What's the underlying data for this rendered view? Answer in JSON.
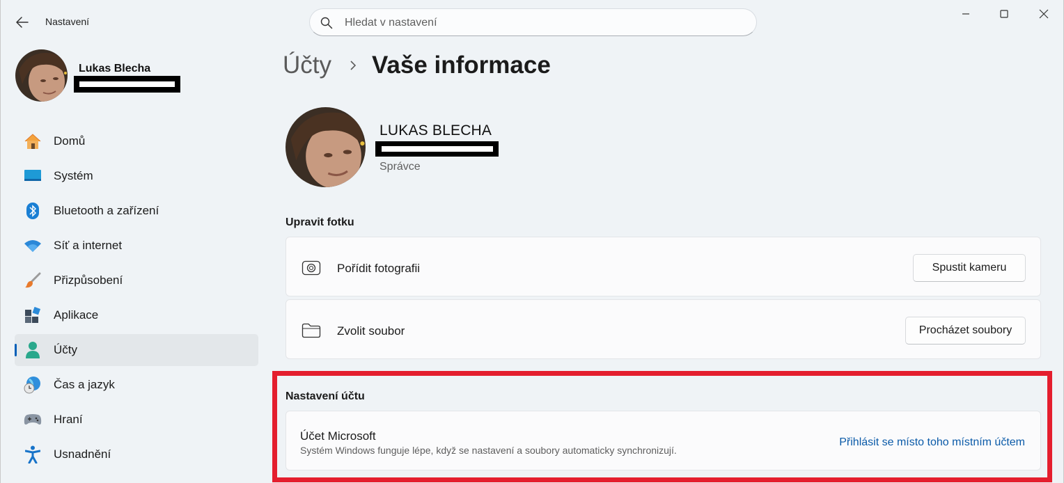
{
  "window": {
    "app_title": "Nastavení",
    "search_placeholder": "Hledat v nastavení"
  },
  "sidebar": {
    "profile_name": "Lukas Blecha",
    "items": [
      {
        "label": "Domů",
        "icon": "home-icon"
      },
      {
        "label": "Systém",
        "icon": "system-icon"
      },
      {
        "label": "Bluetooth a zařízení",
        "icon": "bluetooth-icon"
      },
      {
        "label": "Síť a internet",
        "icon": "wifi-icon"
      },
      {
        "label": "Přizpůsobení",
        "icon": "brush-icon"
      },
      {
        "label": "Aplikace",
        "icon": "apps-icon"
      },
      {
        "label": "Účty",
        "icon": "account-icon",
        "selected": true
      },
      {
        "label": "Čas a jazyk",
        "icon": "globe-clock-icon"
      },
      {
        "label": "Hraní",
        "icon": "gamepad-icon"
      },
      {
        "label": "Usnadnění",
        "icon": "accessibility-icon"
      }
    ]
  },
  "main": {
    "breadcrumb_parent": "Účty",
    "breadcrumb_current": "Vaše informace",
    "user_name": "LUKAS BLECHA",
    "user_role": "Správce",
    "edit_photo": {
      "title": "Upravit fotku",
      "take_photo_label": "Pořídit fotografii",
      "take_photo_button": "Spustit kameru",
      "choose_file_label": "Zvolit soubor",
      "choose_file_button": "Procházet soubory"
    },
    "account_settings": {
      "title": "Nastavení účtu",
      "ms_account_title": "Účet Microsoft",
      "ms_account_desc": "Systém Windows funguje lépe, když se nastavení a soubory automaticky synchronizují.",
      "local_account_link": "Přihlásit se místo toho místním účtem"
    }
  },
  "colors": {
    "accent": "#005fb8",
    "link": "#0a5aa8",
    "highlight_border": "#e41e2e"
  }
}
